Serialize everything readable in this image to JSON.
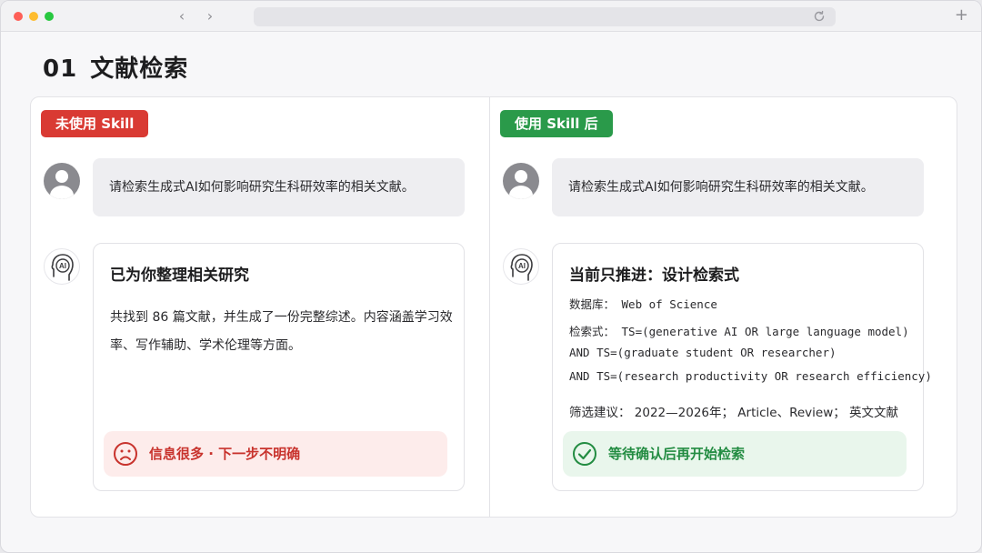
{
  "browser": {
    "back_label": "‹",
    "forward_label": "›",
    "newtab_label": "+"
  },
  "page": {
    "number": "01",
    "title": "文献检索"
  },
  "left": {
    "tag": "未使用 Skill",
    "user_message": "请检索生成式AI如何影响研究生科研效率的相关文献。",
    "card_title": "已为你整理相关研究",
    "card_body": "共找到 86 篇文献，并生成了一份完整综述。内容涵盖学习效率、写作辅助、学术伦理等方面。",
    "status_text": "信息很多 · 下一步不明确",
    "status_icon": "frown-icon",
    "accent": "#d93a33"
  },
  "right": {
    "tag": "使用 Skill 后",
    "user_message": "请检索生成式AI如何影响研究生科研效率的相关文献。",
    "card_title": "当前只推进：设计检索式",
    "database": "数据库： Web of Science",
    "query_line1": "检索式： TS=(generative AI OR large language model)",
    "query_line2": "AND TS=(graduate student OR researcher)",
    "query_line3": "AND TS=(research productivity OR research efficiency)",
    "filter": "筛选建议： 2022—2026年； Article、Review； 英文文献",
    "status_text": "等待确认后再开始检索",
    "status_icon": "check-circle-icon",
    "accent": "#2a9a4a"
  },
  "avatars": {
    "ai_label": "AI"
  }
}
